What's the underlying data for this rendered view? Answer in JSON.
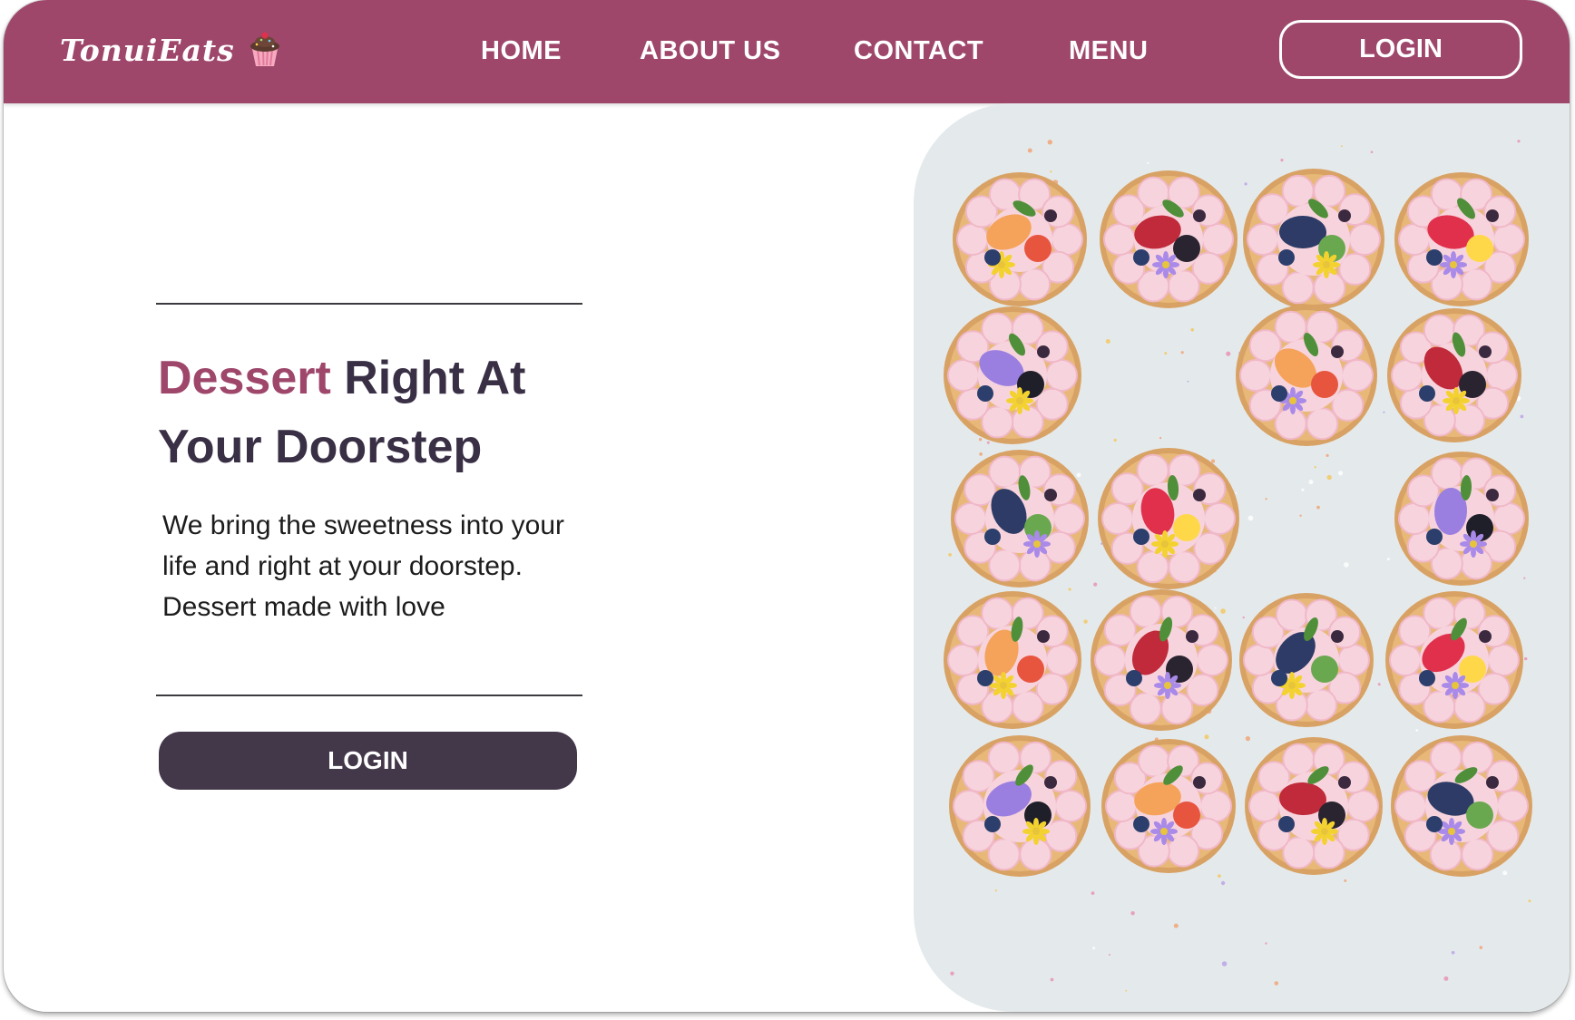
{
  "brand": {
    "name": "TonuiEats",
    "icon": "cupcake-icon"
  },
  "nav": {
    "items": [
      {
        "label": "HOME"
      },
      {
        "label": "ABOUT US"
      },
      {
        "label": "CONTACT"
      },
      {
        "label": "MENU"
      }
    ],
    "login_label": "LOGIN"
  },
  "hero": {
    "headline_accent": "Dessert",
    "headline_rest": " Right At Your Doorstep",
    "description": "We bring the sweetness into your life and right at your doorstep. Dessert made with love",
    "cta_label": "LOGIN",
    "image": "fruit-topped-cupcakes-photo"
  },
  "colors": {
    "brand": "#9e476b",
    "dark": "#43374a",
    "heading": "#3a3046",
    "image_bg": "#e4eaec"
  }
}
